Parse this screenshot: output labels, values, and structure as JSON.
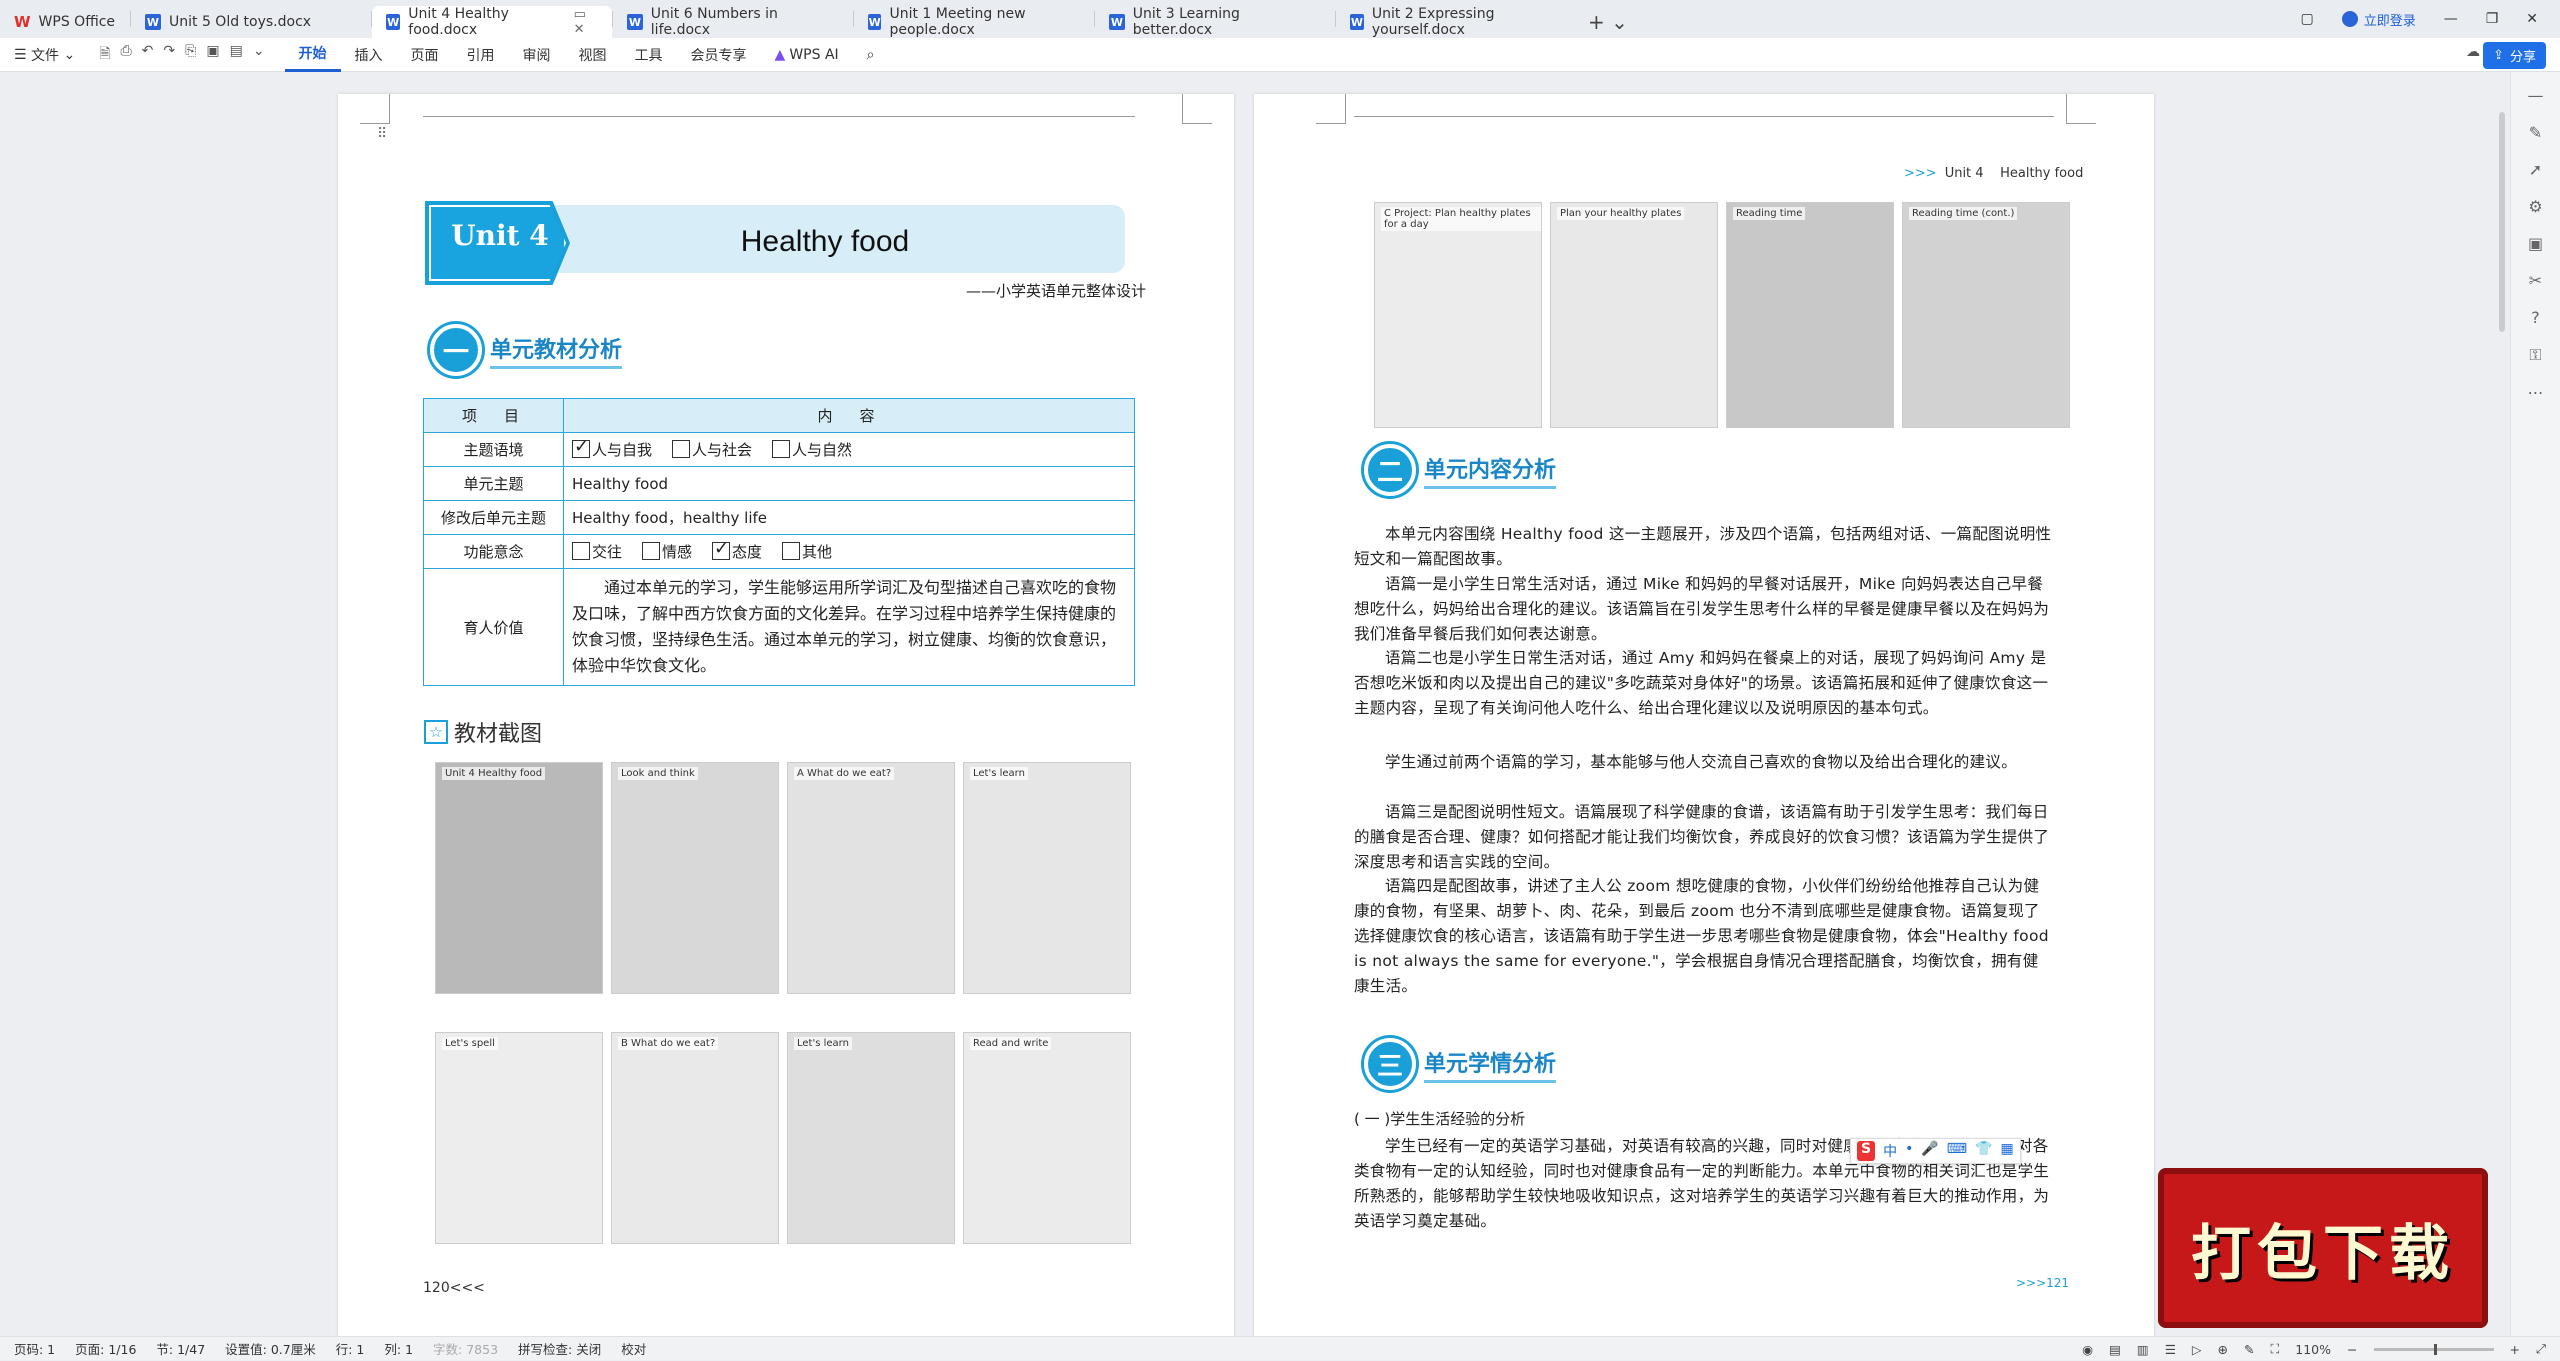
{
  "app": {
    "name": "WPS Office"
  },
  "tabs": [
    {
      "label": "WPS Office",
      "type": "home"
    },
    {
      "label": "Unit 5 Old toys.docx",
      "type": "doc"
    },
    {
      "label": "Unit 4 Healthy food.docx",
      "type": "doc",
      "active": true
    },
    {
      "label": "Unit 6 Numbers in life.docx",
      "type": "doc"
    },
    {
      "label": "Unit 1 Meeting new people.docx",
      "type": "doc"
    },
    {
      "label": "Unit 3 Learning better.docx",
      "type": "doc"
    },
    {
      "label": "Unit 2 Expressing yourself.docx",
      "type": "doc"
    }
  ],
  "window": {
    "login": "立即登录"
  },
  "toolbar": {
    "file": "文件",
    "menus": [
      "开始",
      "插入",
      "页面",
      "引用",
      "审阅",
      "视图",
      "工具",
      "会员专享"
    ],
    "wps_ai": "WPS AI",
    "share": "分享"
  },
  "page1": {
    "unit_label": "Unit 4",
    "unit_title": "Healthy food",
    "subtitle": "——小学英语单元整体设计",
    "section1": {
      "num": "一",
      "title": "单元教材分析"
    },
    "table": {
      "headers": [
        "项　目",
        "内　容"
      ],
      "rows": [
        {
          "key": "主题语境",
          "options": [
            {
              "label": "人与自我",
              "checked": true
            },
            {
              "label": "人与社会",
              "checked": false
            },
            {
              "label": "人与自然",
              "checked": false
            }
          ]
        },
        {
          "key": "单元主题",
          "value": "Healthy food"
        },
        {
          "key": "修改后单元主题",
          "value": "Healthy food，healthy life"
        },
        {
          "key": "功能意念",
          "options": [
            {
              "label": "交往",
              "checked": false
            },
            {
              "label": "情感",
              "checked": false
            },
            {
              "label": "态度",
              "checked": true
            },
            {
              "label": "其他",
              "checked": false
            }
          ]
        },
        {
          "key": "育人价值",
          "value": "通过本单元的学习，学生能够运用所学词汇及句型描述自己喜欢吃的食物及口味，了解中西方饮食方面的文化差异。在学习过程中培养学生保持健康的饮食习惯，坚持绿色生活。通过本单元的学习，树立健康、均衡的饮食意识，体验中华饮食文化。"
        }
      ]
    },
    "shots_title": "教材截图",
    "shots": [
      {
        "label": "Unit 4 Healthy food"
      },
      {
        "label": "Look and think"
      },
      {
        "label": "A What do we eat?"
      },
      {
        "label": "Let's learn"
      },
      {
        "label": "Let's spell"
      },
      {
        "label": "B What do we eat?"
      },
      {
        "label": "Let's learn"
      },
      {
        "label": "Read and write"
      }
    ],
    "page_number": "120<<<"
  },
  "page2": {
    "header_arrows": ">>>",
    "header_unit": "Unit 4",
    "header_title": "Healthy food",
    "shots": [
      {
        "label": "C Project: Plan healthy plates for a day"
      },
      {
        "label": "Plan your healthy plates"
      },
      {
        "label": "Reading time"
      },
      {
        "label": "Reading time (cont.)"
      }
    ],
    "section2": {
      "num": "二",
      "title": "单元内容分析"
    },
    "paras": [
      "本单元内容围绕 Healthy food 这一主题展开，涉及四个语篇，包括两组对话、一篇配图说明性短文和一篇配图故事。",
      "语篇一是小学生日常生活对话，通过 Mike 和妈妈的早餐对话展开，Mike 向妈妈表达自己早餐想吃什么，妈妈给出合理化的建议。该语篇旨在引发学生思考什么样的早餐是健康早餐以及在妈妈为我们准备早餐后我们如何表达谢意。",
      "语篇二也是小学生日常生活对话，通过 Amy 和妈妈在餐桌上的对话，展现了妈妈询问 Amy 是否想吃米饭和肉以及提出自己的建议\"多吃蔬菜对身体好\"的场景。该语篇拓展和延伸了健康饮食这一主题内容，呈现了有关询问他人吃什么、给出合理化建议以及说明原因的基本句式。",
      "学生通过前两个语篇的学习，基本能够与他人交流自己喜欢的食物以及给出合理化的建议。",
      "语篇三是配图说明性短文。语篇展现了科学健康的食谱，该语篇有助于引发学生思考：我们每日的膳食是否合理、健康？如何搭配才能让我们均衡饮食，养成良好的饮食习惯？该语篇为学生提供了深度思考和语言实践的空间。",
      "语篇四是配图故事，讲述了主人公 zoom 想吃健康的食物，小伙伴们纷纷给他推荐自己认为健康的食物，有坚果、胡萝卜、肉、花朵，到最后 zoom 也分不清到底哪些是健康食物。语篇复现了选择健康饮食的核心语言，该语篇有助于学生进一步思考哪些食物是健康食物，体会\"Healthy food is not always the same for everyone.\"，学会根据自身情况合理搭配膳食，均衡饮食，拥有健康生活。"
    ],
    "section3": {
      "num": "三",
      "title": "单元学情分析"
    },
    "sub1": "( 一 )学生生活经验的分析",
    "para_last": "学生已经有一定的英语学习基础，对英语有较高的兴趣，同时对健康饮食也有一定的兴趣，对各类食物有一定的认知经验，同时也对健康食品有一定的判断能力。本单元中食物的相关词汇也是学生所熟悉的，能够帮助学生较快地吸收知识点，这对培养学生的英语学习兴趣有着巨大的推动作用，为英语学习奠定基础。",
    "page_number": ">>>121"
  },
  "ime": {
    "logo": "S",
    "items": [
      "中",
      "•",
      "🎤",
      "⌨",
      "👕",
      "▦"
    ]
  },
  "download_badge": "打包下载",
  "status": {
    "page": "页码: 1",
    "pages": "页面: 1/16",
    "section": "节: 1/47",
    "setting": "设置值: 0.7厘米",
    "row": "行: 1",
    "col": "列: 1",
    "words": "字数: 7853",
    "spell": "拼写检查: 关闭",
    "proof": "校对",
    "zoom": "110%"
  },
  "colors": {
    "accent": "#1aa0d8",
    "brand_blue": "#1f5fd6",
    "download_red": "#c61818"
  }
}
